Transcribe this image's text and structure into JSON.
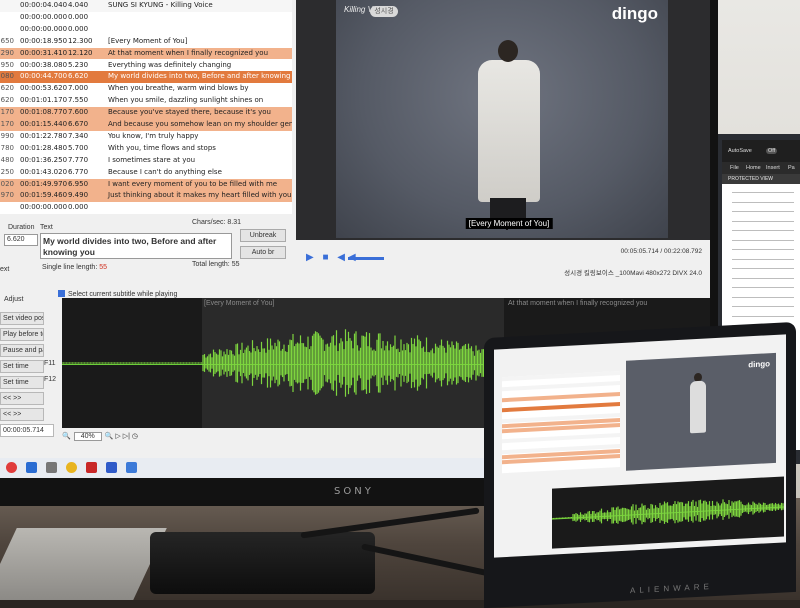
{
  "grid": {
    "rows": [
      {
        "n": "",
        "start": "00:00:04.040",
        "dur": "4.040",
        "text": "SUNG SI KYUNG - Killing Voice",
        "style": "alt"
      },
      {
        "n": "",
        "start": "00:00:00.000",
        "dur": "0.000",
        "text": "",
        "style": ""
      },
      {
        "n": "",
        "start": "00:00:00.000",
        "dur": "0.000",
        "text": "",
        "style": ""
      },
      {
        "n": "650",
        "start": "00:00:18.950",
        "dur": "12.300",
        "text": "[Every Moment of You]",
        "style": ""
      },
      {
        "n": "290",
        "start": "00:00:31.410",
        "dur": "12.120",
        "text": "At that moment when I finally recognized you",
        "style": "hl"
      },
      {
        "n": "950",
        "start": "00:00:38.080",
        "dur": "5.230",
        "text": "Everything was definitely changing",
        "style": ""
      },
      {
        "n": "080",
        "start": "00:00:44.700",
        "dur": "6.620",
        "text": "My world divides into two, Before and after knowing you",
        "style": "sel"
      },
      {
        "n": "620",
        "start": "00:00:53.620",
        "dur": "7.000",
        "text": "When you breathe, warm wind blows by",
        "style": ""
      },
      {
        "n": "620",
        "start": "00:01:01.170",
        "dur": "7.550",
        "text": "When you smile, dazzling sunlight shines on",
        "style": ""
      },
      {
        "n": "170",
        "start": "00:01:08.770",
        "dur": "7.600",
        "text": "Because you've stayed there, because it's you",
        "style": "hl"
      },
      {
        "n": "170",
        "start": "00:01:15.440",
        "dur": "6.670",
        "text": "And because you somehow lean on my shoulder gently",
        "style": "hl"
      },
      {
        "n": "990",
        "start": "00:01:22.780",
        "dur": "7.340",
        "text": "You know, I'm truly happy",
        "style": ""
      },
      {
        "n": "780",
        "start": "00:01:28.480",
        "dur": "5.700",
        "text": "With you, time flows and stops",
        "style": ""
      },
      {
        "n": "480",
        "start": "00:01:36.250",
        "dur": "7.770",
        "text": "I sometimes stare at you",
        "style": ""
      },
      {
        "n": "250",
        "start": "00:01:43.020",
        "dur": "6.770",
        "text": "Because I can't do anything else",
        "style": ""
      },
      {
        "n": "020",
        "start": "00:01:49.970",
        "dur": "6.950",
        "text": "I want every moment of you to be filled with me",
        "style": "hl"
      },
      {
        "n": "970",
        "start": "00:01:59.460",
        "dur": "9.490",
        "text": "Just thinking about it makes my heart filled with you",
        "style": "hl"
      },
      {
        "n": "",
        "start": "00:00:00.000",
        "dur": "0.000",
        "text": "",
        "style": ""
      }
    ]
  },
  "edit": {
    "duration_label": "Duration",
    "duration_value": "6.620",
    "text_label": "Text",
    "chars_sec": "Chars/sec: 8.31",
    "text_value": "My world divides into two, Before and after knowing you",
    "unbreak": "Unbreak",
    "auto_br": "Auto br",
    "single_len_label": "Single line length:",
    "single_len_value": "55",
    "total_len": "Total length: 55",
    "ext": "ext"
  },
  "video": {
    "logo_left": "Killing Voice",
    "logo_badge": "성시경",
    "logo_right": "dingo",
    "subtitle": "[Every Moment of You]",
    "time_position": "00:05:05.714 / 00:22:08.792",
    "file_info": "성시경 킬링보이스 _100Mavi 480x272 DIVX 24.0",
    "play_icons": "▶ ■ ◀◀"
  },
  "adjust": {
    "title": "Adjust",
    "items": [
      "Set video pos",
      "Play before text",
      "Pause and pause",
      "Set time",
      "Set time",
      "<<   >>",
      "<<   >>",
      "00:00:05.714"
    ],
    "f11": "F11",
    "f12": "F12"
  },
  "waveform": {
    "checkbox": "Select current subtitle while playing",
    "label_current": "[Every Moment of You]",
    "label_next": "At that moment when I finally recognized you",
    "zoom": "40%"
  },
  "monitor_brand": "SONY",
  "laptop_brand": "ALIENWARE",
  "excel": {
    "autosave": "AutoSave",
    "off": "Off",
    "menu": [
      "File",
      "Home",
      "Insert",
      "Pa"
    ],
    "protected": "PROTECTED VIEW"
  },
  "colors": {
    "highlight": "#f2b28c",
    "selected": "#e27a3e",
    "wave": "#7ed53f",
    "accent": "#3a6fd8"
  }
}
